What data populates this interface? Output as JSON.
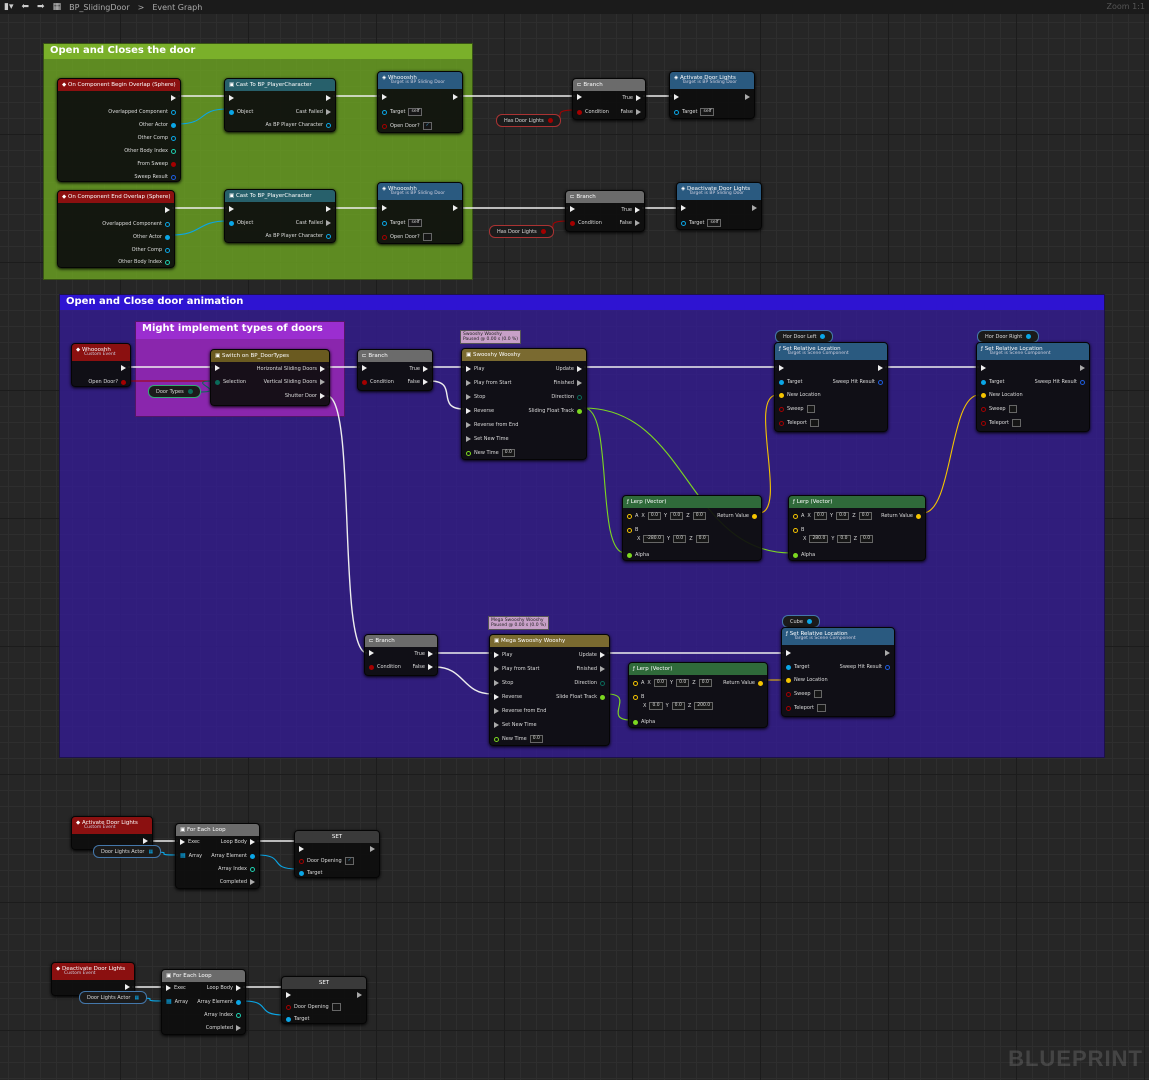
{
  "toolbar": {
    "blueprint": "BP_SlidingDoor",
    "separator": ">",
    "graph": "Event Graph",
    "zoom": "Zoom 1:1"
  },
  "watermark": "BLUEPRINT",
  "comments": {
    "c1": "Open and Closes the door",
    "c2": "Open and Close door animation",
    "c3": "Might implement types of doors"
  },
  "n1": {
    "title": "On Component Begin Overlap (Sphere)",
    "p1": "Overlapped Component",
    "p2": "Other Actor",
    "p3": "Other Comp",
    "p4": "Other Body Index",
    "p5": "From Sweep",
    "p6": "Sweep Result"
  },
  "n2": {
    "title": "Cast To BP_PlayerCharacter",
    "p1": "Object",
    "p2": "Cast Failed",
    "p3": "As BP Player Character"
  },
  "n3": {
    "title": "Whoooshh",
    "sub": "Target is BP Sliding Door",
    "p1": "Target",
    "v1": "self",
    "p2": "Open Door?"
  },
  "n4": {
    "title": "Branch",
    "p1": "True",
    "p2": "Condition",
    "p3": "False"
  },
  "n5": {
    "title": "Activate Door Lights",
    "sub": "Target is BP Sliding Door",
    "p1": "Target",
    "v1": "self"
  },
  "chip1": "Has Door Lights",
  "n6": {
    "title": "On Component End Overlap (Sphere)",
    "p1": "Overlapped Component",
    "p2": "Other Actor",
    "p3": "Other Comp",
    "p4": "Other Body Index"
  },
  "n7": {
    "title": "Cast To BP_PlayerCharacter",
    "p1": "Object",
    "p2": "Cast Failed",
    "p3": "As BP Player Character"
  },
  "n8": {
    "title": "Whoooshh",
    "sub": "Target is BP Sliding Door",
    "p1": "Target",
    "v1": "self",
    "p2": "Open Door?"
  },
  "n9": {
    "title": "Branch",
    "p1": "True",
    "p2": "Condition",
    "p3": "False"
  },
  "n10": {
    "title": "Deactivate Door Lights",
    "sub": "Target is BP Sliding Door",
    "p1": "Target",
    "v1": "self"
  },
  "chip2": "Has Door Lights",
  "n11": {
    "title": "Whoooshh",
    "sub": "Custom Event",
    "p1": "Open Door?"
  },
  "n12": {
    "title": "Switch on BP_DoorTypes",
    "p1": "Horizontal Sliding Doors",
    "p2": "Selection",
    "p3": "Vertical Sliding Doors",
    "p4": "Shutter Door"
  },
  "chip3": "Door Types",
  "n13": {
    "title": "Branch",
    "p1": "True",
    "p2": "Condition",
    "p3": "False"
  },
  "tag1": "Swooshy Wooshy\nPaused @ 0.00 s (0.0 %)",
  "n14": {
    "title": "Swooshy Wooshy",
    "p1": "Play",
    "p2": "Update",
    "p3": "Play from Start",
    "p4": "Finished",
    "p5": "Stop",
    "p6": "Direction",
    "p7": "Reverse",
    "p8": "Sliding Float Track",
    "p9": "Reverse from End",
    "p10": "Set New Time",
    "p11": "New Time",
    "v11": "0.0"
  },
  "chip4": "Hor Door Left",
  "n15": {
    "title": "Set Relative Location",
    "sub": "Target is Scene Component",
    "p1": "Target",
    "p2": "Sweep Hit Result",
    "p3": "New Location",
    "p4": "Sweep",
    "p5": "Teleport"
  },
  "chip5": "Hor Door Right",
  "n16": {
    "title": "Set Relative Location",
    "sub": "Target is Scene Component",
    "p1": "Target",
    "p2": "Sweep Hit Result",
    "p3": "New Location",
    "p4": "Sweep",
    "p5": "Teleport"
  },
  "n17": {
    "title": "Lerp (Vector)",
    "pA": "A",
    "pAx": "X",
    "vAx": "0.0",
    "pAy": "Y",
    "vAy": "0.0",
    "pAz": "Z",
    "vAz": "0.0",
    "pR": "Return Value",
    "pB": "B",
    "pBx": "X",
    "vBx": "-280.0",
    "pBy": "Y",
    "vBy": "0.0",
    "pBz": "Z",
    "vBz": "0.0",
    "pAl": "Alpha"
  },
  "n18": {
    "title": "Lerp (Vector)",
    "pA": "A",
    "pAx": "X",
    "vAx": "0.0",
    "pAy": "Y",
    "vAy": "0.0",
    "pAz": "Z",
    "vAz": "0.0",
    "pR": "Return Value",
    "pB": "B",
    "pBx": "X",
    "vBx": "280.0",
    "pBy": "Y",
    "vBy": "0.0",
    "pBz": "Z",
    "vBz": "0.0",
    "pAl": "Alpha"
  },
  "n19": {
    "title": "Branch",
    "p1": "True",
    "p2": "Condition",
    "p3": "False"
  },
  "tag2": "Mega Swooshy Wooshy\nPaused @ 0.00 s (0.0 %)",
  "n20": {
    "title": "Mega Swooshy Wooshy",
    "p1": "Play",
    "p2": "Update",
    "p3": "Play from Start",
    "p4": "Finished",
    "p5": "Stop",
    "p6": "Direction",
    "p7": "Reverse",
    "p8": "Slide Float Track",
    "p9": "Reverse from End",
    "p10": "Set New Time",
    "p11": "New Time",
    "v11": "0.0"
  },
  "chip6": "Cube",
  "n21": {
    "title": "Set Relative Location",
    "sub": "Target is Scene Component",
    "p1": "Target",
    "p2": "Sweep Hit Result",
    "p3": "New Location",
    "p4": "Sweep",
    "p5": "Teleport"
  },
  "n22": {
    "title": "Lerp (Vector)",
    "pA": "A",
    "pAx": "X",
    "vAx": "0.0",
    "pAy": "Y",
    "vAy": "0.0",
    "pAz": "Z",
    "vAz": "0.0",
    "pR": "Return Value",
    "pB": "B",
    "pBx": "X",
    "vBx": "0.0",
    "pBy": "Y",
    "vBy": "0.0",
    "pBz": "Z",
    "vBz": "200.0",
    "pAl": "Alpha"
  },
  "n23": {
    "title": "Activate Door Lights",
    "sub": "Custom Event"
  },
  "chip7": "Door Lights Actor",
  "n24": {
    "title": "For Each Loop",
    "p1": "Exec",
    "p2": "Loop Body",
    "p3": "Array",
    "p4": "Array Element",
    "p5": "Array Index",
    "p6": "Completed"
  },
  "n25": {
    "title": "SET",
    "p1": "Door Opening",
    "p2": "Target"
  },
  "n26": {
    "title": "Deactivate Door Lights",
    "sub": "Custom Event"
  },
  "chip8": "Door Lights Actor",
  "n27": {
    "title": "For Each Loop",
    "p1": "Exec",
    "p2": "Loop Body",
    "p3": "Array",
    "p4": "Array Element",
    "p5": "Array Index",
    "p6": "Completed"
  },
  "n28": {
    "title": "SET",
    "p1": "Door Opening",
    "p2": "Target"
  },
  "colors": {
    "exec": "#eeeeee",
    "object": "#0aa6e6",
    "bool": "#a40000",
    "vector": "#f5c400",
    "float": "#7cd820",
    "struct": "#1e5ee0",
    "byte": "#0a6a5a",
    "event": "#8b1010",
    "function": "#2a5a80",
    "cast": "#27606b",
    "macro": "#6b6b6b",
    "timeline": "#7a6a30",
    "switch": "#6a5a20"
  }
}
